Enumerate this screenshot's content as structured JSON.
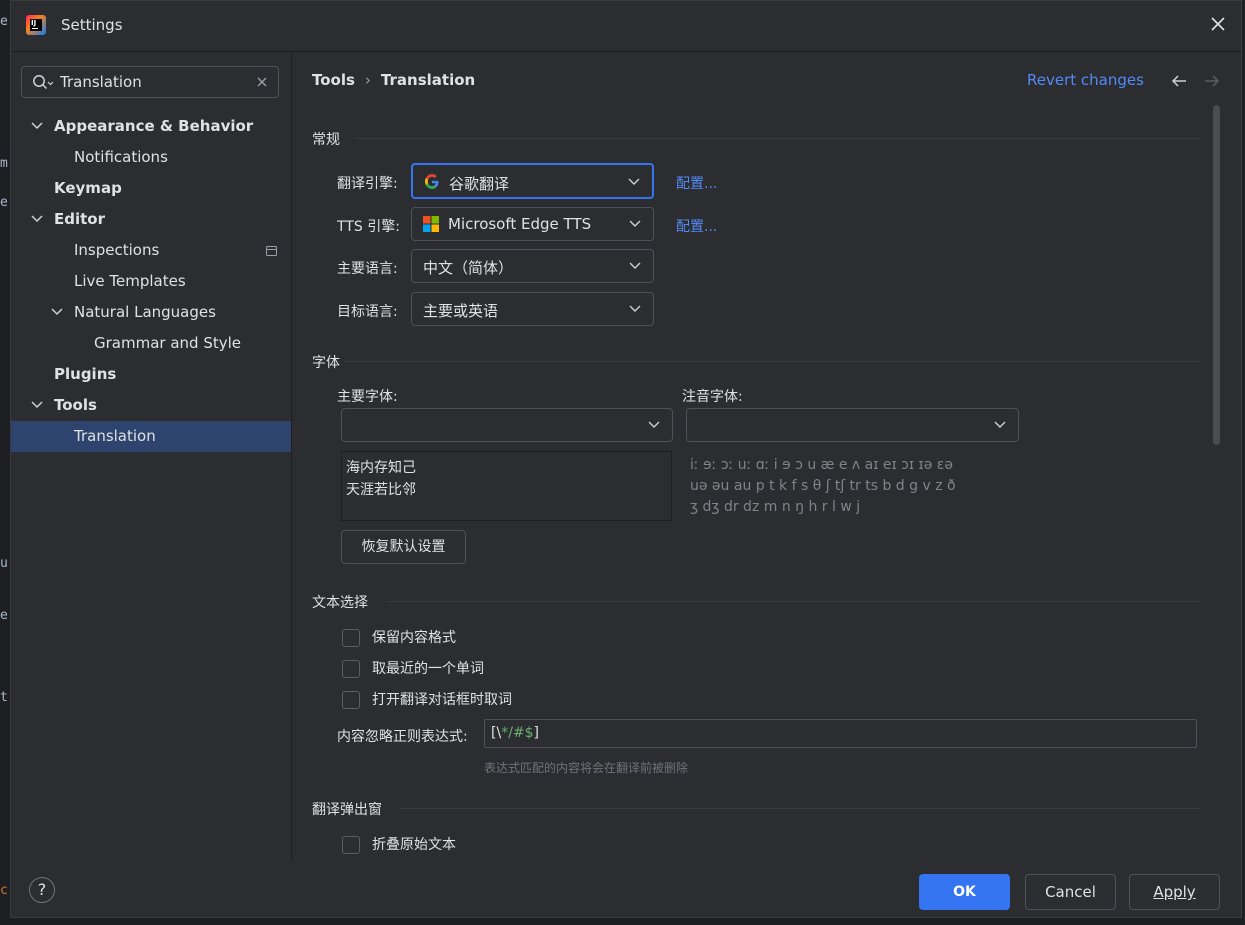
{
  "window": {
    "title": "Settings"
  },
  "search": {
    "value": "Translation"
  },
  "sidebar": {
    "items": [
      {
        "label": "Appearance & Behavior"
      },
      {
        "label": "Notifications"
      },
      {
        "label": "Keymap"
      },
      {
        "label": "Editor"
      },
      {
        "label": "Inspections"
      },
      {
        "label": "Live Templates"
      },
      {
        "label": "Natural Languages"
      },
      {
        "label": "Grammar and Style"
      },
      {
        "label": "Plugins"
      },
      {
        "label": "Tools"
      },
      {
        "label": "Translation"
      }
    ]
  },
  "breadcrumb": {
    "parent": "Tools",
    "separator": "›",
    "current": "Translation"
  },
  "header": {
    "revert": "Revert changes"
  },
  "general": {
    "title": "常规",
    "engine_label": "翻译引擎:",
    "engine_value": "谷歌翻译",
    "engine_configure": "配置...",
    "tts_label": "TTS 引擎:",
    "tts_value": "Microsoft Edge TTS",
    "tts_configure": "配置...",
    "primary_lang_label": "主要语言:",
    "primary_lang_value": "中文（简体）",
    "target_lang_label": "目标语言:",
    "target_lang_value": "主要或英语"
  },
  "fonts": {
    "title": "字体",
    "primary_label": "主要字体:",
    "phonetic_label": "注音字体:",
    "preview_line1": "海内存知己",
    "preview_line2": "天涯若比邻",
    "phonetic_line1": "iː ɘː ɔː uː ɑː i ɘ ɔ u æ e ʌ aɪ eɪ ɔɪ ɪə ɛə",
    "phonetic_line2": "uə əu au p t k f s θ ʃ tʃ tr ts b d g v z ð",
    "phonetic_line3": "ʒ dʒ dr dz m n ŋ h r l w j",
    "reset_button": "恢复默认设置"
  },
  "selection": {
    "title": "文本选择",
    "keep_format": "保留内容格式",
    "take_nearest_word": "取最近的一个单词",
    "take_word_on_open": "打开翻译对话框时取词",
    "ignore_regex_label": "内容忽略正则表达式:",
    "ignore_regex_part1": "[\\",
    "ignore_regex_part2": "*/#$",
    "ignore_regex_part3": "]",
    "ignore_regex_hint": "表达式匹配的内容将会在翻译前被删除"
  },
  "popup": {
    "title": "翻译弹出窗",
    "fold_original": "折叠原始文本"
  },
  "footer": {
    "help": "?",
    "ok": "OK",
    "cancel": "Cancel",
    "apply": "Apply"
  },
  "colors": {
    "accent": "#3574f0",
    "link": "#548af7",
    "selection": "#2e436e",
    "background": "#2b2d30"
  }
}
